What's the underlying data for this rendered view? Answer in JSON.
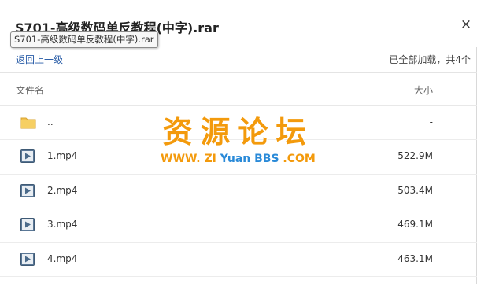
{
  "dialog": {
    "title": "S701-高级数码单反教程(中字).rar",
    "tooltip": "S701-高级数码单反教程(中字).rar",
    "close_glyph": "×"
  },
  "nav": {
    "back_label": "返回上一级",
    "status": "已全部加载，共4个"
  },
  "table": {
    "headers": {
      "name": "文件名",
      "size": "大小"
    },
    "rows": [
      {
        "name": "..",
        "size": "-",
        "icon": "folder-icon"
      },
      {
        "name": "1.mp4",
        "size": "522.9M",
        "icon": "video-file-icon"
      },
      {
        "name": "2.mp4",
        "size": "503.4M",
        "icon": "video-file-icon"
      },
      {
        "name": "3.mp4",
        "size": "469.1M",
        "icon": "video-file-icon"
      },
      {
        "name": "4.mp4",
        "size": "463.1M",
        "icon": "video-file-icon"
      }
    ]
  },
  "watermark": {
    "cn": "资源论坛",
    "en_part1": "WWW. ZI ",
    "en_part2": "Yuan BBS",
    "en_part3": " .COM"
  },
  "colors": {
    "link": "#2b5ea8",
    "watermark_orange": "#f39a0c",
    "watermark_blue": "#2a8ad8",
    "folder": "#f2c14e",
    "video_icon": "#4a6a8a"
  }
}
